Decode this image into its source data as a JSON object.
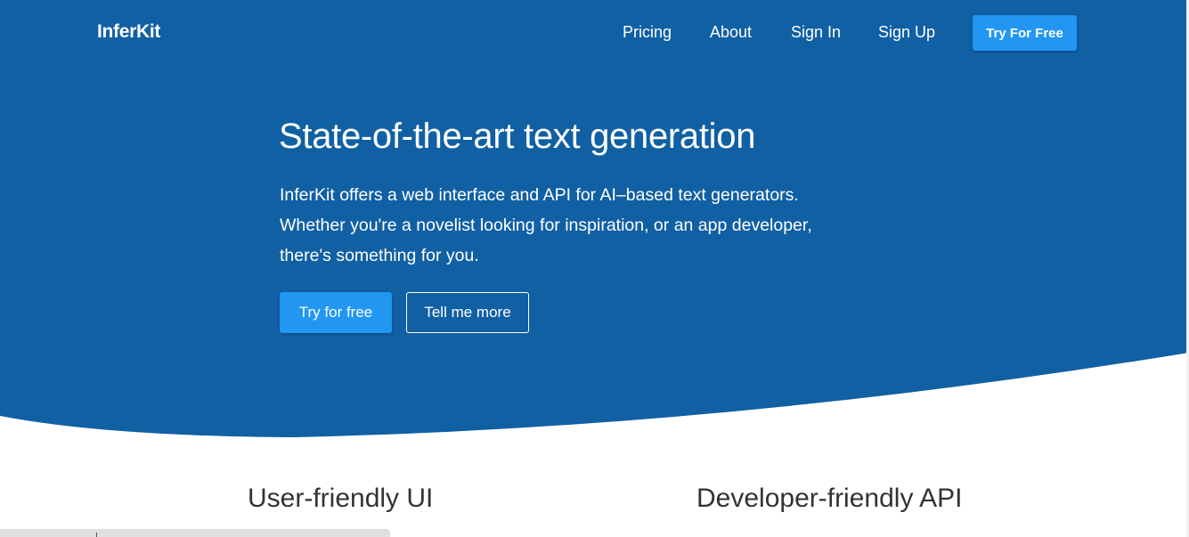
{
  "colors": {
    "hero_bg": "#1160a3",
    "accent": "#2196f3",
    "heading_text": "#333333"
  },
  "nav": {
    "brand": "InferKit",
    "links": [
      "Pricing",
      "About",
      "Sign In",
      "Sign Up"
    ],
    "cta": "Try For Free"
  },
  "hero": {
    "title": "State-of-the-art text generation",
    "description_lines": [
      "InferKit offers a web interface and API for AI–based text generators.",
      "Whether you're a novelist looking for inspiration, or an app developer,",
      "there's something for you."
    ],
    "primary_button": "Try for free",
    "secondary_button": "Tell me more"
  },
  "features": {
    "left_heading": "User-friendly UI",
    "right_heading": "Developer-friendly API"
  }
}
